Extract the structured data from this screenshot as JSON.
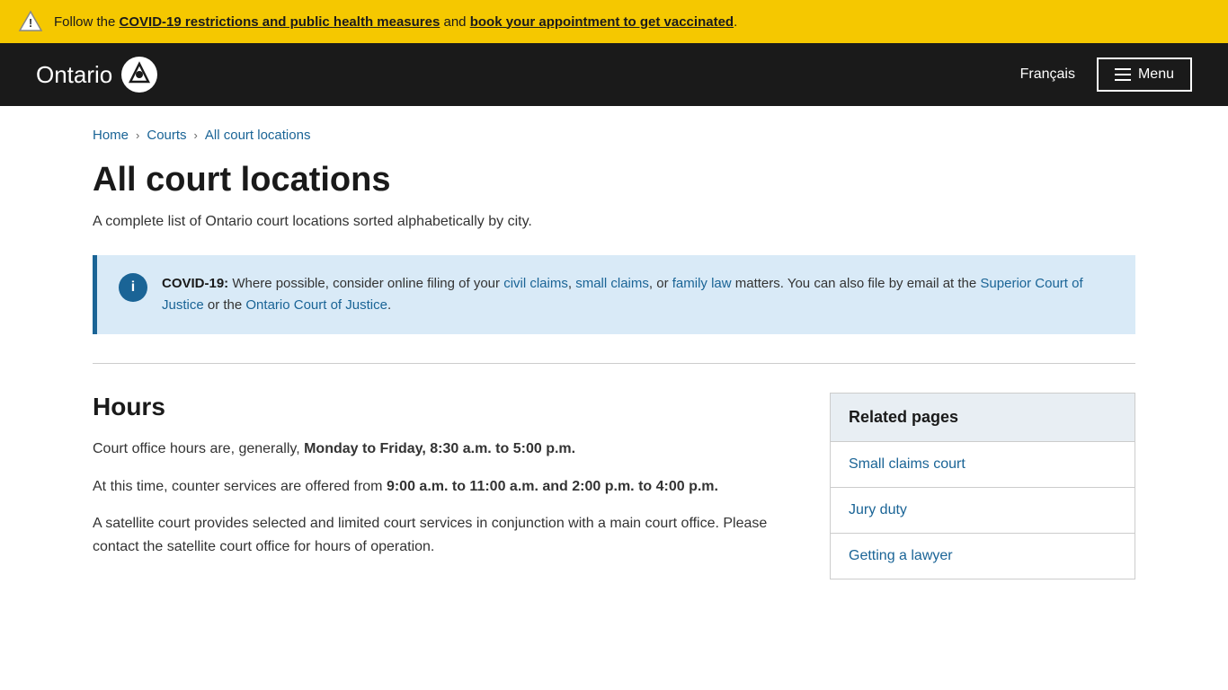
{
  "alert": {
    "text_before": "Follow the ",
    "link1_text": "COVID-19 restrictions and public health measures",
    "text_middle": " and ",
    "link2_text": "book your appointment to get vaccinated",
    "text_after": "."
  },
  "header": {
    "logo_text": "Ontario",
    "francais_label": "Français",
    "menu_label": "Menu"
  },
  "breadcrumb": {
    "home": "Home",
    "courts": "Courts",
    "current": "All court locations"
  },
  "page": {
    "title": "All court locations",
    "subtitle": "A complete list of Ontario court locations sorted alphabetically by city."
  },
  "info_box": {
    "icon": "i",
    "label": "COVID-19:",
    "text_before": " Where possible, consider online filing of your ",
    "link1": "civil claims",
    "separator1": ", ",
    "link2": "small claims",
    "text_mid1": ", or ",
    "link3": "family law",
    "text_mid2": " matters. You can also file by email at the ",
    "link4": "Superior Court of Justice",
    "text_mid3": " or the ",
    "link5": "Ontario Court of Justice",
    "text_end": "."
  },
  "hours": {
    "section_title": "Hours",
    "para1_before": "Court office hours are, generally, ",
    "para1_bold": "Monday to Friday, 8:30 a.m. to 5:00 p.m.",
    "para2_before": "At this time, counter services are offered from ",
    "para2_bold": "9:00 a.m. to 11:00 a.m. and 2:00 p.m. to 4:00 p.m.",
    "para3": "A satellite court provides selected and limited court services in conjunction with a main court office. Please contact the satellite court office for hours of operation."
  },
  "related_pages": {
    "header": "Related pages",
    "items": [
      {
        "label": "Small claims court"
      },
      {
        "label": "Jury duty"
      },
      {
        "label": "Getting a lawyer"
      }
    ]
  }
}
